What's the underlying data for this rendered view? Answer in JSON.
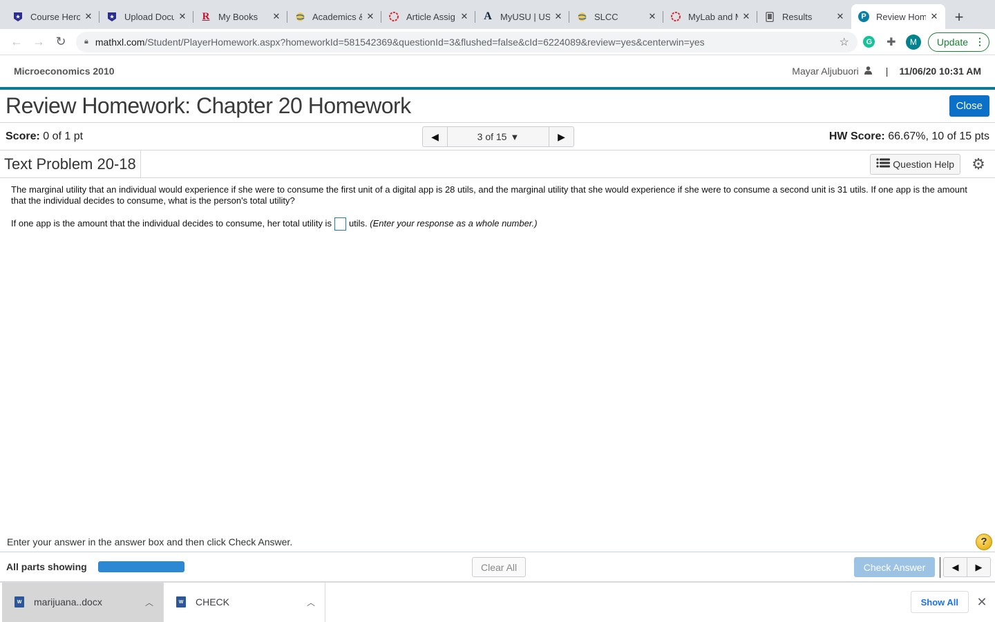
{
  "browser": {
    "tabs": [
      {
        "title": "Course Hero",
        "icon": "course-hero-icon",
        "active": false
      },
      {
        "title": "Upload Docu",
        "icon": "course-hero-icon",
        "active": false
      },
      {
        "title": "My Books",
        "icon": "r-books-icon",
        "active": false
      },
      {
        "title": "Academics &",
        "icon": "globe-icon",
        "active": false
      },
      {
        "title": "Article Assig",
        "icon": "pearson-ring-icon",
        "active": false
      },
      {
        "title": "MyUSU | US",
        "icon": "usu-a-icon",
        "active": false
      },
      {
        "title": "SLCC",
        "icon": "globe-icon",
        "active": false
      },
      {
        "title": "MyLab and M",
        "icon": "pearson-ring-icon",
        "active": false
      },
      {
        "title": "Results",
        "icon": "document-icon",
        "active": false
      },
      {
        "title": "Review Hom",
        "icon": "pearson-p-icon",
        "active": true
      }
    ],
    "url_host": "mathxl.com",
    "url_rest": "/Student/PlayerHomework.aspx?homeworkId=581542369&questionId=3&flushed=false&cId=6224089&review=yes&centerwin=yes",
    "profile_initial": "M",
    "grammarly_initial": "G",
    "update_label": "Update"
  },
  "header": {
    "course": "Microeconomics 2010",
    "user": "Mayar Aljubuori",
    "separator": "|",
    "datetime": "11/06/20 10:31 AM"
  },
  "page": {
    "title": "Review Homework: Chapter 20 Homework",
    "close_label": "Close"
  },
  "score": {
    "label": "Score:",
    "value": "0 of 1 pt",
    "question_position": "3 of 15",
    "hw_label": "HW Score:",
    "hw_value": "66.67%, 10 of 15 pts"
  },
  "problem": {
    "title": "Text Problem 20-18",
    "help_label": "Question Help",
    "text": "The marginal utility that an individual would experience if she were to consume the first unit of a digital app is 28 utils, and the marginal utility that she would experience if she were to consume a second unit is 31 utils. If one app is the amount that the individual decides to consume, what is the person's total utility?",
    "answer_prefix": "If one app is the amount that the individual decides to consume, her total utility is",
    "answer_value": "",
    "answer_suffix": "utils.",
    "answer_hint": "(Enter your response as a whole number.)"
  },
  "footer": {
    "instruction": "Enter your answer in the answer box and then click Check Answer.",
    "help_glyph": "?",
    "parts_label": "All parts showing",
    "parts_progress_percent": 100,
    "clear_label": "Clear All",
    "check_label": "Check Answer"
  },
  "downloads": {
    "items": [
      {
        "name": "marijuana..docx"
      },
      {
        "name": "CHECK"
      }
    ],
    "show_all_label": "Show All"
  }
}
